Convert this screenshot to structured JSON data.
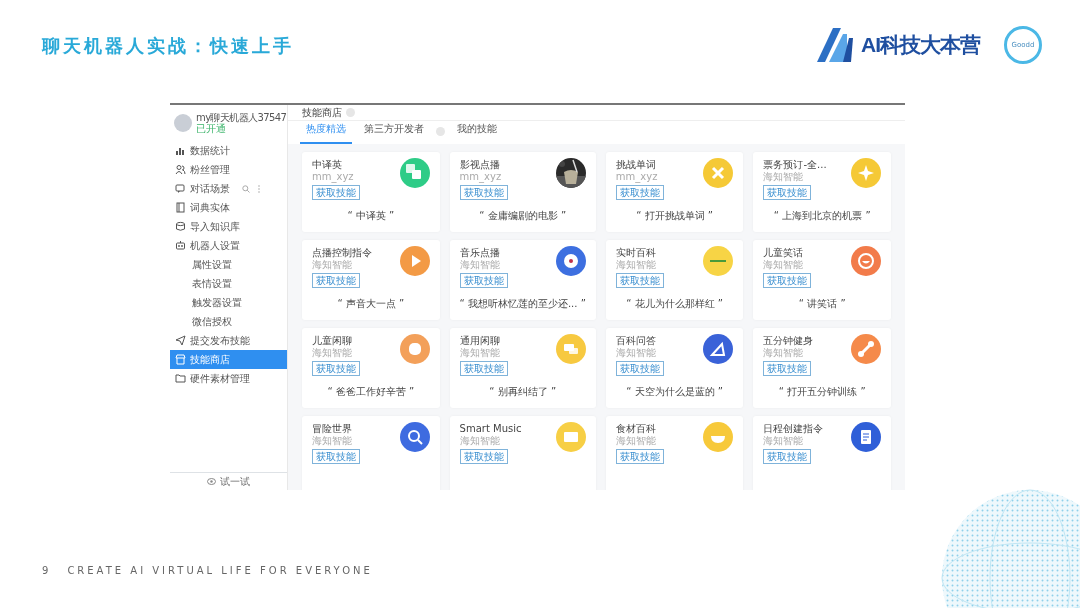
{
  "slide": {
    "title": "聊天机器人实战：快速上手",
    "logo_text": "AI科技大本营",
    "badge_text": "Goodd",
    "page_number": "9",
    "footer": "CREATE AI VIRTUAL LIFE FOR EVERYONE"
  },
  "app": {
    "profile": {
      "name": "my聊天机器人37547",
      "status": "已开通"
    },
    "sidebar": {
      "items": [
        {
          "label": "数据统计",
          "selected": false
        },
        {
          "label": "粉丝管理",
          "selected": false
        },
        {
          "label": "对话场景",
          "selected": false
        },
        {
          "label": "词典实体",
          "selected": false
        },
        {
          "label": "导入知识库",
          "selected": false
        },
        {
          "label": "机器人设置",
          "selected": false,
          "children": [
            {
              "label": "属性设置",
              "selected": false
            },
            {
              "label": "表情设置",
              "selected": false
            },
            {
              "label": "触发器设置",
              "selected": false
            },
            {
              "label": "微信授权",
              "selected": false
            }
          ]
        },
        {
          "label": "提交发布技能",
          "selected": false
        },
        {
          "label": "技能商店",
          "selected": true
        },
        {
          "label": "硬件素材管理",
          "selected": false
        }
      ],
      "bottom": "试一试"
    },
    "header": "技能商店",
    "tabs": [
      {
        "label": "热度精选",
        "selected": true
      },
      {
        "label": "第三方开发者",
        "selected": false
      },
      {
        "label": "我的技能",
        "selected": false
      }
    ],
    "cards": [
      {
        "kind": "icon",
        "title": "中译英",
        "subtitle": "mm_xyz",
        "button": "获取技能",
        "example": "“ 中译英 ”",
        "color": "#2ecc87"
      },
      {
        "kind": "picture",
        "title": "影视点播",
        "subtitle": "mm_xyz",
        "button": "获取技能",
        "example": "“ 金庸编剧的电影 ”"
      },
      {
        "kind": "icon",
        "title": "挑战单词",
        "subtitle": "mm_xyz",
        "button": "获取技能",
        "example": "“ 打开挑战单词 ”",
        "color": "#f5c936"
      },
      {
        "kind": "icon",
        "title": "票务预订-全...",
        "subtitle": "海知智能",
        "button": "获取技能",
        "example": "“ 上海到北京的机票 ”",
        "color": "#f5c936"
      },
      {
        "kind": "icon",
        "title": "点播控制指令",
        "subtitle": "海知智能",
        "button": "获取技能",
        "example": "“ 声音大一点 ”",
        "color": "#f39a45"
      },
      {
        "kind": "icon",
        "title": "音乐点播",
        "subtitle": "海知智能",
        "button": "获取技能",
        "example": "“ 我想听林忆莲的至少还... ”",
        "color": "#3d6fe0"
      },
      {
        "kind": "icon",
        "title": "实时百科",
        "subtitle": "海知智能",
        "button": "获取技能",
        "example": "“ 花儿为什么那样红 ”",
        "color": "#f7d445"
      },
      {
        "kind": "icon",
        "title": "儿童笑话",
        "subtitle": "海知智能",
        "button": "获取技能",
        "example": "“ 讲笑话 ”",
        "color": "#f27b4a"
      },
      {
        "kind": "icon",
        "title": "儿童闲聊",
        "subtitle": "海知智能",
        "button": "获取技能",
        "example": "“ 爸爸工作好辛苦 ”",
        "color": "#f3a05a"
      },
      {
        "kind": "icon",
        "title": "通用闲聊",
        "subtitle": "海知智能",
        "button": "获取技能",
        "example": "“ 别再纠结了 ”",
        "color": "#f7c940"
      },
      {
        "kind": "icon",
        "title": "百科问答",
        "subtitle": "海知智能",
        "button": "获取技能",
        "example": "“ 天空为什么是蓝的 ”",
        "color": "#3a62d8"
      },
      {
        "kind": "icon",
        "title": "五分钟健身",
        "subtitle": "海知智能",
        "button": "获取技能",
        "example": "“ 打开五分钟训练 ”",
        "color": "#f58a4a"
      },
      {
        "kind": "icon",
        "title": "冒险世界",
        "subtitle": "海知智能",
        "button": "获取技能",
        "color": "#3e6be0"
      },
      {
        "kind": "icon",
        "title": "Smart Music",
        "subtitle": "海知智能",
        "button": "获取技能",
        "color": "#f7cf45"
      },
      {
        "kind": "icon",
        "title": "食材百科",
        "subtitle": "海知智能",
        "button": "获取技能",
        "color": "#f7c93a"
      },
      {
        "kind": "icon",
        "title": "日程创建指令",
        "subtitle": "海知智能",
        "button": "获取技能",
        "color": "#2f5fd8"
      }
    ]
  }
}
